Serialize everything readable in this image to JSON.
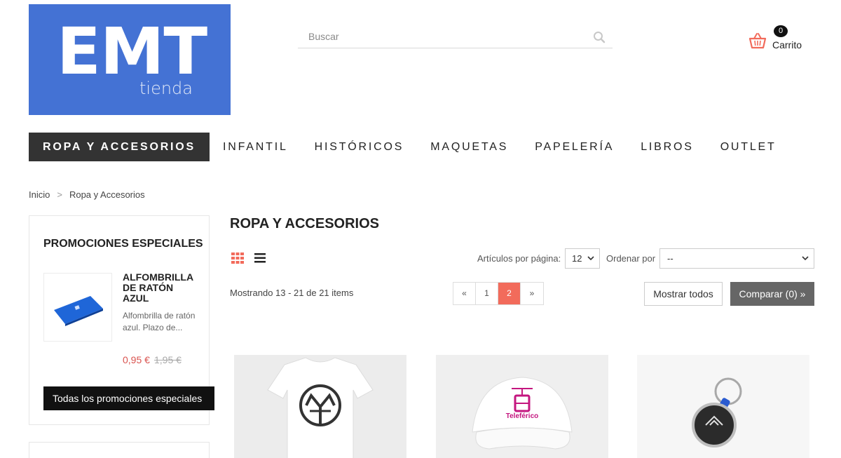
{
  "logo": {
    "main": "EMT",
    "sub": "tienda"
  },
  "search": {
    "placeholder": "Buscar"
  },
  "cart": {
    "count": "0",
    "label": "Carrito"
  },
  "nav": {
    "items": [
      {
        "label": "ROPA Y ACCESORIOS"
      },
      {
        "label": "INFANTIL"
      },
      {
        "label": "HISTÓRICOS"
      },
      {
        "label": "MAQUETAS"
      },
      {
        "label": "PAPELERÍA"
      },
      {
        "label": "LIBROS"
      },
      {
        "label": "OUTLET"
      }
    ]
  },
  "breadcrumb": {
    "home": "Inicio",
    "separator": ">",
    "current": "Ropa y Accesorios"
  },
  "sidebar": {
    "title": "PROMOCIONES ESPECIALES",
    "promo": {
      "name": "ALFOMBRILLA DE RATÓN AZUL",
      "description": "Alfombrilla de ratón azul. Plazo de...",
      "price": "0,95 €",
      "old_price": "1,95 €"
    },
    "all_button": "Todas los promociones especiales"
  },
  "main": {
    "title": "ROPA Y ACCESORIOS",
    "per_page_label": "Artículos por página:",
    "per_page_value": "12",
    "order_label": "Ordenar por",
    "order_value": "--",
    "showing": "Mostrando 13 - 21 de 21 items",
    "pager": {
      "prev": "«",
      "pages": [
        "1",
        "2"
      ],
      "current_page": "2",
      "next": "»"
    },
    "show_all": "Mostrar todos",
    "compare": "Comparar (0) »"
  },
  "products": [
    {
      "image": "t-shirt-emt-logo"
    },
    {
      "image": "cap-teleferico",
      "print_text": "Teleférico"
    },
    {
      "image": "keychain-emt"
    }
  ],
  "colors": {
    "brand_blue": "#4472d4",
    "accent": "#f26b5b",
    "price_red": "#d9534f"
  }
}
